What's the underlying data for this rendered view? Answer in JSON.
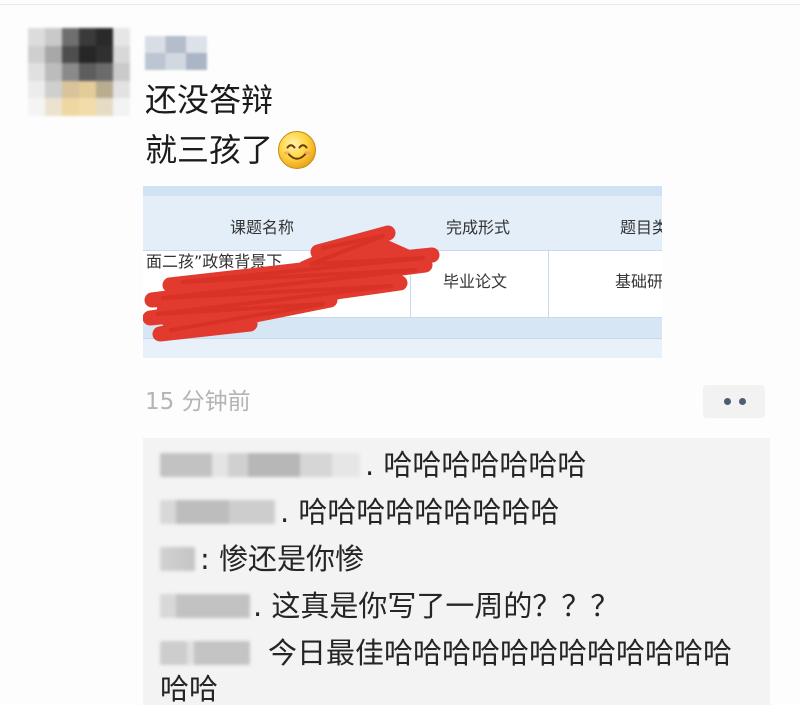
{
  "post": {
    "text_lines": [
      "还没答辩",
      "就三孩了"
    ],
    "emoji_icon": "smile-emoji-icon",
    "timestamp": "15 分钟前",
    "more_icon": "more-dots-icon"
  },
  "attachment": {
    "headers": [
      "课题名称",
      "完成形式",
      "题目类"
    ],
    "row": [
      "面二孩”政策背景下",
      "毕业论文",
      "基础研"
    ],
    "redaction_color": "#e23a2e"
  },
  "comments": [
    {
      "text": ". 哈哈哈哈哈哈哈"
    },
    {
      "text": ". 哈哈哈哈哈哈哈哈哈"
    },
    {
      "text": ": 惨还是你惨"
    },
    {
      "text": ". 这真是你写了一周的？？？"
    },
    {
      "text": "今日最佳哈哈哈哈哈哈哈哈哈哈哈哈哈哈"
    }
  ],
  "colors": {
    "comment_panel_bg": "#f3f3f3",
    "timestamp": "#b4b4b4"
  }
}
